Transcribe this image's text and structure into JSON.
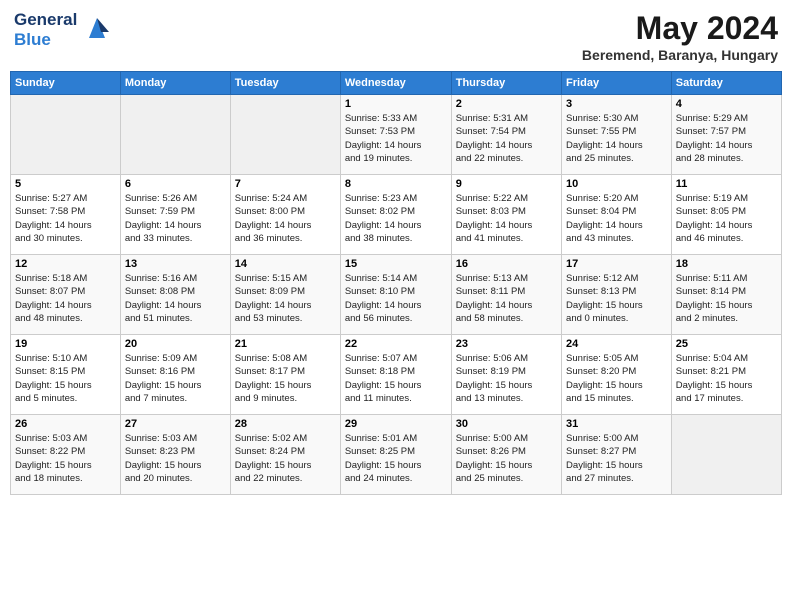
{
  "header": {
    "logo_line1": "General",
    "logo_line2": "Blue",
    "month": "May 2024",
    "location": "Beremend, Baranya, Hungary"
  },
  "weekdays": [
    "Sunday",
    "Monday",
    "Tuesday",
    "Wednesday",
    "Thursday",
    "Friday",
    "Saturday"
  ],
  "weeks": [
    [
      {
        "day": "",
        "info": ""
      },
      {
        "day": "",
        "info": ""
      },
      {
        "day": "",
        "info": ""
      },
      {
        "day": "1",
        "info": "Sunrise: 5:33 AM\nSunset: 7:53 PM\nDaylight: 14 hours\nand 19 minutes."
      },
      {
        "day": "2",
        "info": "Sunrise: 5:31 AM\nSunset: 7:54 PM\nDaylight: 14 hours\nand 22 minutes."
      },
      {
        "day": "3",
        "info": "Sunrise: 5:30 AM\nSunset: 7:55 PM\nDaylight: 14 hours\nand 25 minutes."
      },
      {
        "day": "4",
        "info": "Sunrise: 5:29 AM\nSunset: 7:57 PM\nDaylight: 14 hours\nand 28 minutes."
      }
    ],
    [
      {
        "day": "5",
        "info": "Sunrise: 5:27 AM\nSunset: 7:58 PM\nDaylight: 14 hours\nand 30 minutes."
      },
      {
        "day": "6",
        "info": "Sunrise: 5:26 AM\nSunset: 7:59 PM\nDaylight: 14 hours\nand 33 minutes."
      },
      {
        "day": "7",
        "info": "Sunrise: 5:24 AM\nSunset: 8:00 PM\nDaylight: 14 hours\nand 36 minutes."
      },
      {
        "day": "8",
        "info": "Sunrise: 5:23 AM\nSunset: 8:02 PM\nDaylight: 14 hours\nand 38 minutes."
      },
      {
        "day": "9",
        "info": "Sunrise: 5:22 AM\nSunset: 8:03 PM\nDaylight: 14 hours\nand 41 minutes."
      },
      {
        "day": "10",
        "info": "Sunrise: 5:20 AM\nSunset: 8:04 PM\nDaylight: 14 hours\nand 43 minutes."
      },
      {
        "day": "11",
        "info": "Sunrise: 5:19 AM\nSunset: 8:05 PM\nDaylight: 14 hours\nand 46 minutes."
      }
    ],
    [
      {
        "day": "12",
        "info": "Sunrise: 5:18 AM\nSunset: 8:07 PM\nDaylight: 14 hours\nand 48 minutes."
      },
      {
        "day": "13",
        "info": "Sunrise: 5:16 AM\nSunset: 8:08 PM\nDaylight: 14 hours\nand 51 minutes."
      },
      {
        "day": "14",
        "info": "Sunrise: 5:15 AM\nSunset: 8:09 PM\nDaylight: 14 hours\nand 53 minutes."
      },
      {
        "day": "15",
        "info": "Sunrise: 5:14 AM\nSunset: 8:10 PM\nDaylight: 14 hours\nand 56 minutes."
      },
      {
        "day": "16",
        "info": "Sunrise: 5:13 AM\nSunset: 8:11 PM\nDaylight: 14 hours\nand 58 minutes."
      },
      {
        "day": "17",
        "info": "Sunrise: 5:12 AM\nSunset: 8:13 PM\nDaylight: 15 hours\nand 0 minutes."
      },
      {
        "day": "18",
        "info": "Sunrise: 5:11 AM\nSunset: 8:14 PM\nDaylight: 15 hours\nand 2 minutes."
      }
    ],
    [
      {
        "day": "19",
        "info": "Sunrise: 5:10 AM\nSunset: 8:15 PM\nDaylight: 15 hours\nand 5 minutes."
      },
      {
        "day": "20",
        "info": "Sunrise: 5:09 AM\nSunset: 8:16 PM\nDaylight: 15 hours\nand 7 minutes."
      },
      {
        "day": "21",
        "info": "Sunrise: 5:08 AM\nSunset: 8:17 PM\nDaylight: 15 hours\nand 9 minutes."
      },
      {
        "day": "22",
        "info": "Sunrise: 5:07 AM\nSunset: 8:18 PM\nDaylight: 15 hours\nand 11 minutes."
      },
      {
        "day": "23",
        "info": "Sunrise: 5:06 AM\nSunset: 8:19 PM\nDaylight: 15 hours\nand 13 minutes."
      },
      {
        "day": "24",
        "info": "Sunrise: 5:05 AM\nSunset: 8:20 PM\nDaylight: 15 hours\nand 15 minutes."
      },
      {
        "day": "25",
        "info": "Sunrise: 5:04 AM\nSunset: 8:21 PM\nDaylight: 15 hours\nand 17 minutes."
      }
    ],
    [
      {
        "day": "26",
        "info": "Sunrise: 5:03 AM\nSunset: 8:22 PM\nDaylight: 15 hours\nand 18 minutes."
      },
      {
        "day": "27",
        "info": "Sunrise: 5:03 AM\nSunset: 8:23 PM\nDaylight: 15 hours\nand 20 minutes."
      },
      {
        "day": "28",
        "info": "Sunrise: 5:02 AM\nSunset: 8:24 PM\nDaylight: 15 hours\nand 22 minutes."
      },
      {
        "day": "29",
        "info": "Sunrise: 5:01 AM\nSunset: 8:25 PM\nDaylight: 15 hours\nand 24 minutes."
      },
      {
        "day": "30",
        "info": "Sunrise: 5:00 AM\nSunset: 8:26 PM\nDaylight: 15 hours\nand 25 minutes."
      },
      {
        "day": "31",
        "info": "Sunrise: 5:00 AM\nSunset: 8:27 PM\nDaylight: 15 hours\nand 27 minutes."
      },
      {
        "day": "",
        "info": ""
      }
    ]
  ]
}
